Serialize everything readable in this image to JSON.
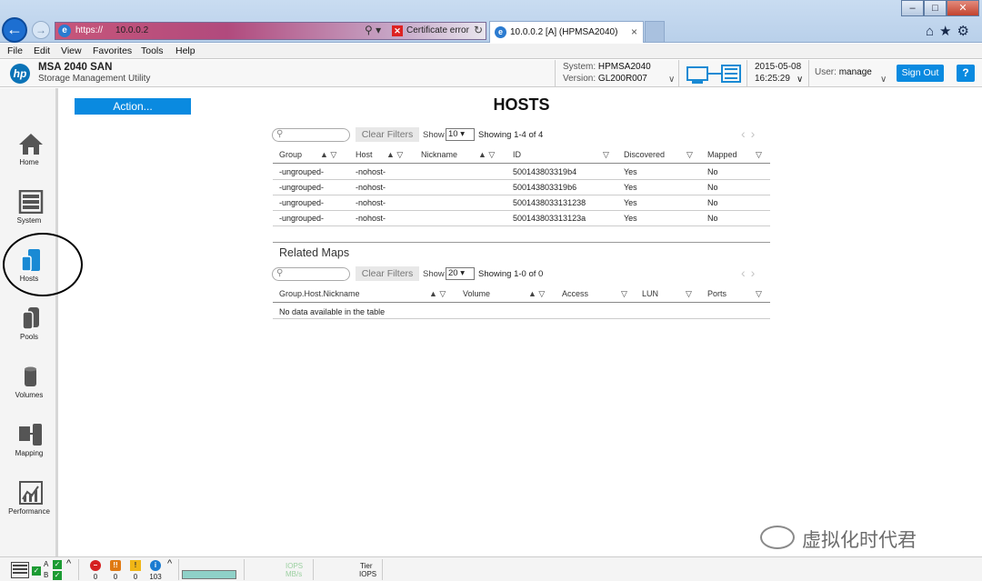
{
  "browser": {
    "url_scheme": "https://",
    "url_host": "10.0.0.2",
    "cert_error": "Certificate error",
    "tab_title": "10.0.0.2 [A] (HPMSA2040)",
    "tab_close": "×",
    "menu": [
      "File",
      "Edit",
      "View",
      "Favorites",
      "Tools",
      "Help"
    ],
    "window_buttons": [
      "–",
      "□",
      "✕"
    ],
    "toolbar_icons": "⌂★⚙"
  },
  "header": {
    "logo": "hp",
    "product": "MSA 2040 SAN",
    "subtitle": "Storage Management Utility",
    "system_label": "System:",
    "system_value": "HPMSA2040",
    "version_label": "Version:",
    "version_value": "GL200R007",
    "date": "2015-05-08",
    "time": "16:25:29",
    "user_label": "User:",
    "user_value": "manage",
    "sign_out": "Sign Out",
    "help": "?"
  },
  "nav": [
    {
      "label": "Home",
      "icon": "home-icon"
    },
    {
      "label": "System",
      "icon": "system-icon"
    },
    {
      "label": "Hosts",
      "icon": "hosts-icon"
    },
    {
      "label": "Pools",
      "icon": "pools-icon"
    },
    {
      "label": "Volumes",
      "icon": "volumes-icon"
    },
    {
      "label": "Mapping",
      "icon": "mapping-icon"
    },
    {
      "label": "Performance",
      "icon": "performance-icon"
    }
  ],
  "main": {
    "action": "Action...",
    "title": "HOSTS",
    "hosts_table": {
      "clear_filters": "Clear Filters",
      "show_label": "Show",
      "show_value": "10",
      "showing": "Showing 1-4 of 4",
      "columns": [
        "Group",
        "Host",
        "Nickname",
        "ID",
        "Discovered",
        "Mapped"
      ],
      "rows": [
        [
          "-ungrouped-",
          "-nohost-",
          "",
          "500143803319b4",
          "Yes",
          "No"
        ],
        [
          "-ungrouped-",
          "-nohost-",
          "",
          "500143803319b6",
          "Yes",
          "No"
        ],
        [
          "-ungrouped-",
          "-nohost-",
          "",
          "5001438033131238",
          "Yes",
          "No"
        ],
        [
          "-ungrouped-",
          "-nohost-",
          "",
          "500143803313123a",
          "Yes",
          "No"
        ]
      ]
    },
    "related_maps": {
      "title": "Related Maps",
      "clear_filters": "Clear Filters",
      "show_label": "Show",
      "show_value": "20",
      "showing": "Showing 1-0 of 0",
      "columns": [
        "Group.Host.Nickname",
        "Volume",
        "Access",
        "LUN",
        "Ports"
      ],
      "empty": "No data available in the table"
    }
  },
  "statusbar": {
    "ctrl_a": "A",
    "ctrl_b": "B",
    "counts": [
      "0",
      "0",
      "0",
      "103"
    ],
    "iops": "IOPS",
    "mbs": "MB/s",
    "tier": "Tier",
    "tier_iops": "IOPS"
  },
  "watermark": "虚拟化时代君",
  "colors": {
    "accent": "#0a8ae0",
    "ok": "#1c9b33"
  }
}
